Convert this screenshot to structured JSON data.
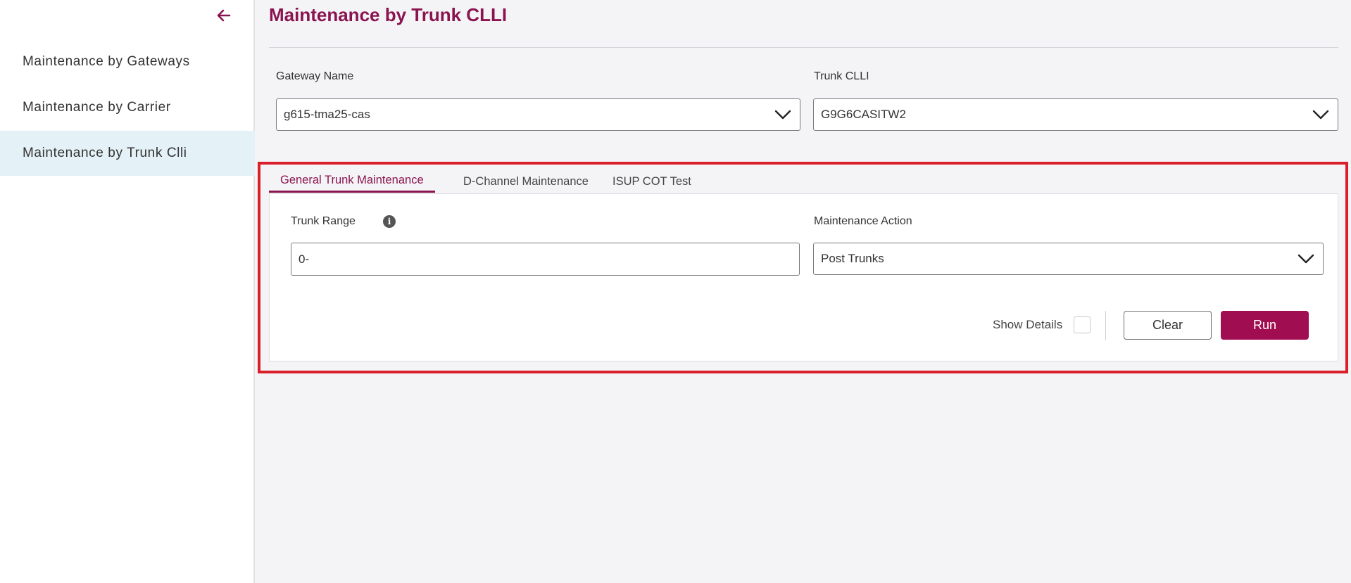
{
  "sidebar": {
    "back_icon": "arrow-left-icon",
    "items": [
      {
        "label": "Maintenance by Gateways",
        "active": false
      },
      {
        "label": "Maintenance by Carrier",
        "active": false
      },
      {
        "label": "Maintenance by Trunk Clli",
        "active": true
      }
    ]
  },
  "main": {
    "title": "Maintenance by Trunk CLLI",
    "gateway": {
      "label": "Gateway Name",
      "value": "g615-tma25-cas"
    },
    "trunk_clli": {
      "label": "Trunk CLLI",
      "value": "G9G6CASITW2"
    },
    "tabs": [
      {
        "label": "General Trunk Maintenance",
        "active": true
      },
      {
        "label": "D-Channel Maintenance",
        "active": false
      },
      {
        "label": "ISUP COT Test",
        "active": false
      }
    ],
    "panel": {
      "trunk_range": {
        "label": "Trunk Range",
        "value": "0-",
        "info_icon": "info-icon"
      },
      "maintenance_action": {
        "label": "Maintenance Action",
        "value": "Post Trunks"
      },
      "show_details_label": "Show Details",
      "show_details_checked": false,
      "clear_label": "Clear",
      "run_label": "Run"
    }
  },
  "colors": {
    "brand": "#8a1450",
    "run_button": "#a00d51",
    "active_nav_bg": "#e4f1f7",
    "highlight_frame": "#d9202a",
    "page_bg": "#f4f4f6"
  }
}
